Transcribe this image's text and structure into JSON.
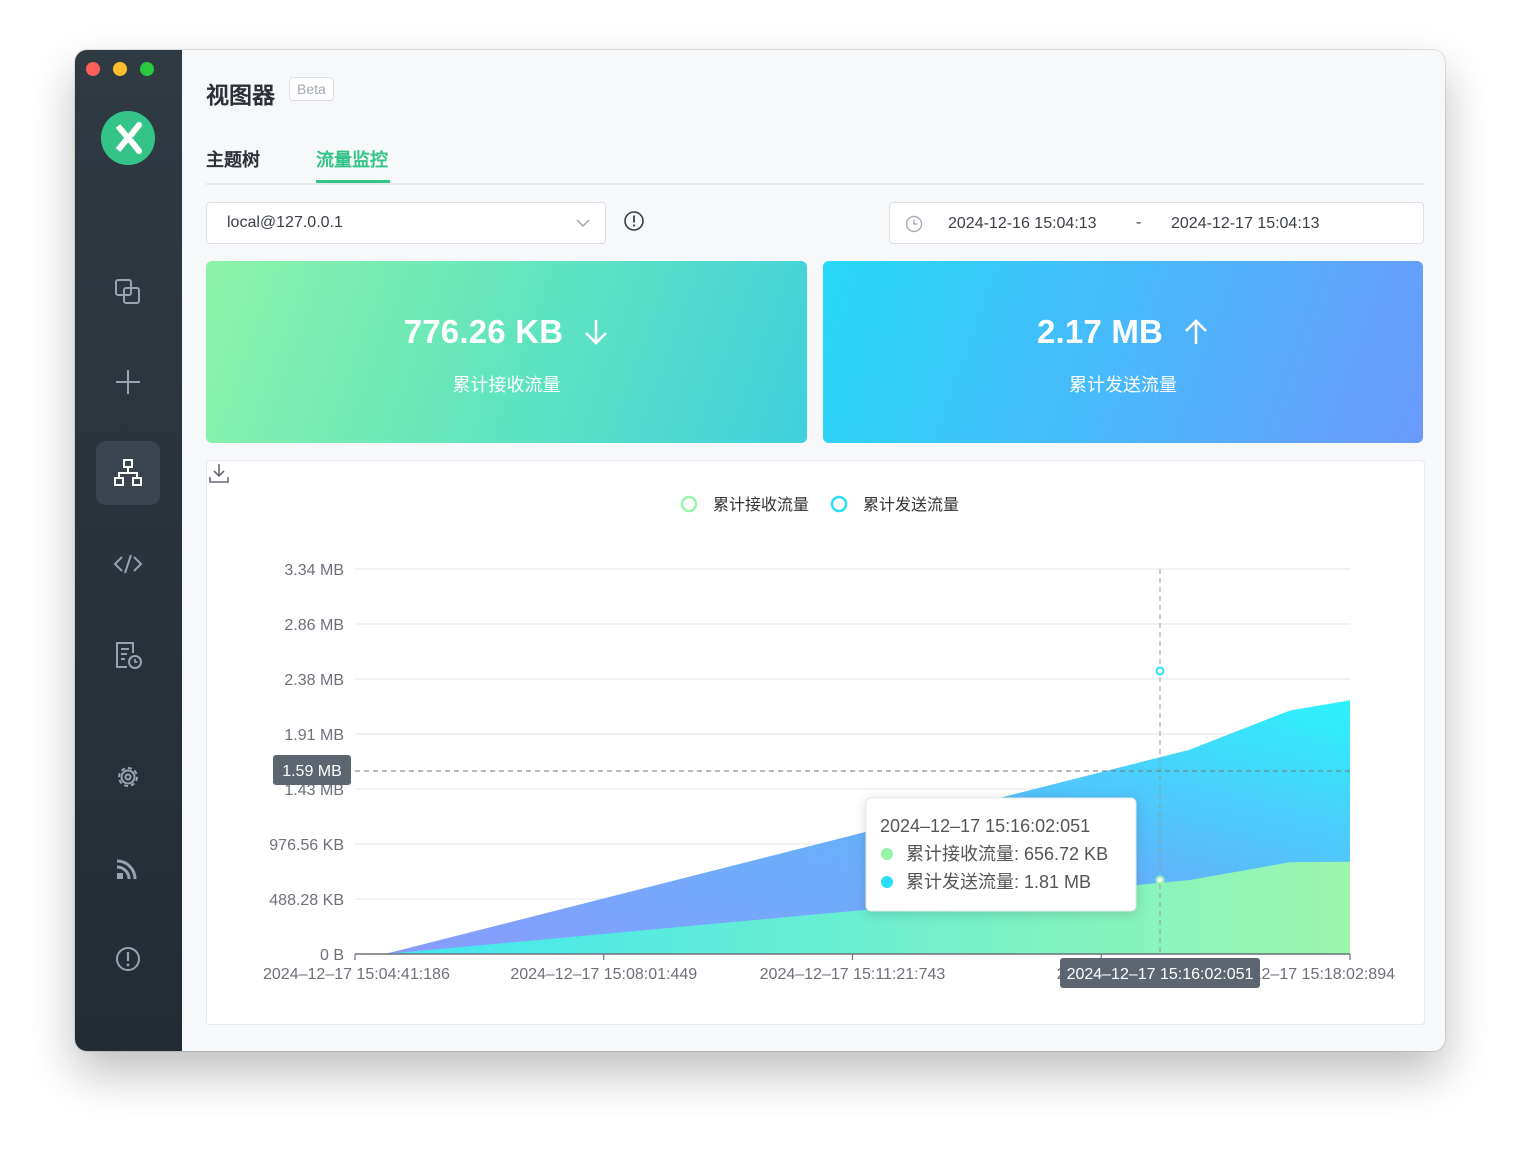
{
  "app": {
    "title": "视图器",
    "badge": "Beta"
  },
  "sidebar": {
    "items": [
      {
        "name": "connections",
        "icon": "copy-windows-icon",
        "active": false
      },
      {
        "name": "new-connection",
        "icon": "plus-icon",
        "active": false
      },
      {
        "name": "viewer",
        "icon": "topology-icon",
        "active": true
      },
      {
        "name": "script",
        "icon": "code-icon",
        "active": false
      },
      {
        "name": "log",
        "icon": "log-clock-icon",
        "active": false
      },
      {
        "name": "settings",
        "icon": "gear-icon",
        "active": false
      },
      {
        "name": "benchmark",
        "icon": "rss-icon",
        "active": false
      },
      {
        "name": "about",
        "icon": "info-icon",
        "active": false
      }
    ]
  },
  "tabs": [
    {
      "label": "主题树",
      "active": false
    },
    {
      "label": "流量监控",
      "active": true
    }
  ],
  "connection_select": {
    "value": "local@127.0.0.1"
  },
  "date_range": {
    "start": "2024-12-16 15:04:13",
    "separator": "-",
    "end": "2024-12-17 15:04:13"
  },
  "stats": {
    "received": {
      "value": "776.26 KB",
      "label": "累计接收流量",
      "direction": "down"
    },
    "sent": {
      "value": "2.17 MB",
      "label": "累计发送流量",
      "direction": "up"
    }
  },
  "colors": {
    "accent": "#34c388",
    "received_series": "#96f5a8",
    "sent_series": "#2bdcf8"
  },
  "chart_data": {
    "type": "area",
    "stacked": true,
    "legend_position": "top-center",
    "grid": true,
    "y_ticks": [
      "0 B",
      "488.28 KB",
      "976.56 KB",
      "1.43 MB",
      "1.91 MB",
      "2.38 MB",
      "2.86 MB",
      "3.34 MB"
    ],
    "y_unit": "MB",
    "ylim": [
      0,
      3.5
    ],
    "x_ticks": [
      "2024–12–17 15:04:41:186",
      "2024–12–17 15:08:01:449",
      "2024–12–17 15:11:21:743",
      "2024–12–17",
      "2024–12–17 15:18:02:894"
    ],
    "x_tick_positions_min": [
      0,
      3.34,
      6.68,
      10.02,
      13.36
    ],
    "xlim_min": [
      0,
      13.36
    ],
    "series": [
      {
        "name": "累计接收流量",
        "color": "#96f5a8",
        "x_min": [
          0,
          0.4,
          11.2,
          12.55,
          13.36
        ],
        "values_mb": [
          0,
          0,
          0.64,
          0.795,
          0.8
        ]
      },
      {
        "name": "累计发送流量",
        "color": "#2bdcf8",
        "x_min": [
          0,
          0.4,
          11.2,
          12.55,
          13.36
        ],
        "values_mb": [
          0,
          0,
          1.77,
          2.11,
          2.2
        ]
      }
    ],
    "crosshair": {
      "x_label": "2024–12–17 15:16:02:051",
      "y_label": "1.59 MB",
      "x_min": 13.36,
      "y_mb": 1.665
    },
    "tooltip": {
      "time": "2024–12–17 15:16:02:051",
      "rows": [
        {
          "label": "累计接收流量",
          "value": "656.72 KB",
          "color": "#96f5a8"
        },
        {
          "label": "累计发送流量",
          "value": "1.81 MB",
          "color": "#2bdcf8"
        }
      ]
    }
  }
}
